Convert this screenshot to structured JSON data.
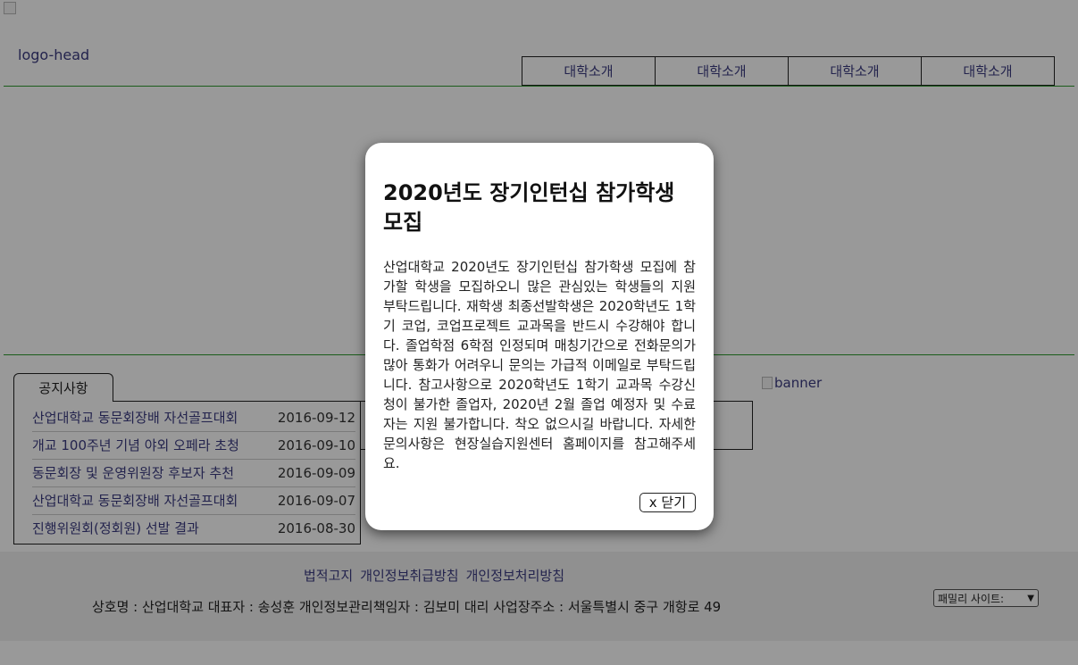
{
  "header": {
    "logo_alt": "logo-head",
    "nav": [
      "대학소개",
      "대학소개",
      "대학소개",
      "대학소개"
    ]
  },
  "notice": {
    "tab_label": "공지사항",
    "items": [
      {
        "title": "산업대학교 동문회장배 자선골프대회",
        "date": "2016-09-12"
      },
      {
        "title": "개교 100주년 기념 야외 오페라 초청",
        "date": "2016-09-10"
      },
      {
        "title": "동문회장 및 운영위원장 후보자 추천",
        "date": "2016-09-09"
      },
      {
        "title": "산업대학교 동문회장배 자선골프대회",
        "date": "2016-09-07"
      },
      {
        "title": "진행위원회(정회원) 선발 결과",
        "date": "2016-08-30"
      }
    ]
  },
  "banner_alt": "banner",
  "footer": {
    "links": [
      "법적고지",
      "개인정보취급방침",
      "개인정보처리방침"
    ],
    "info": "상호명 : 산업대학교 대표자 : 송성훈 개인정보관리책임자 : 김보미 대리 사업장주소 : 서울특별시 중구 개항로 49",
    "family_site": "패밀리 사이트:"
  },
  "modal": {
    "title": "2020년도 장기인턴십 참가학생 모집",
    "body": "산업대학교 2020년도 장기인턴십 참가학생 모집에 참가할 학생을 모집하오니 많은 관심있는 학생들의 지원 부탁드립니다. 재학생 최종선발학생은 2020학년도 1학기 코업, 코업프로젝트 교과목을 반드시 수강해야 합니다. 졸업학점 6학점 인정되며 매칭기간으로 전화문의가 많아 통화가 어려우니 문의는 가급적 이메일로 부탁드립니다. 참고사항으로 2020학년도 1학기 교과목 수강신청이 불가한 졸업자, 2020년 2월 졸업 예정자 및 수료자는 지원 불가합니다. 착오 없으시길 바랍니다. 자세한 문의사항은 현장실습지원센터 홈페이지를 참고해주세요.",
    "close_label": "x 닫기"
  }
}
